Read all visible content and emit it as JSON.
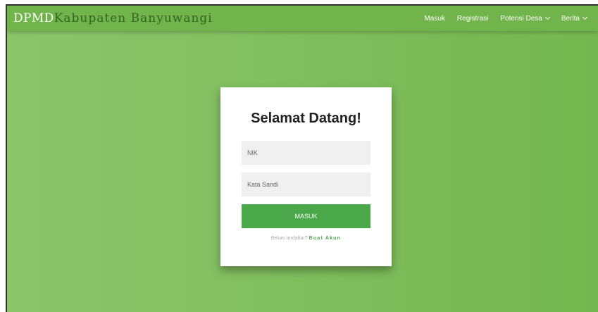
{
  "navbar": {
    "brand_strong": "DPMD",
    "brand_light": "Kabupaten Banyuwangi",
    "links": [
      {
        "label": "Masuk"
      },
      {
        "label": "Registrasi"
      },
      {
        "label": "Potensi Desa"
      },
      {
        "label": "Berita"
      }
    ]
  },
  "login": {
    "title": "Selamat Datang!",
    "nik_placeholder": "NIK",
    "password_placeholder": "Kata Sandi",
    "submit_label": "MASUK",
    "signup_prompt": "Belum terdaftar?",
    "signup_link": "Buat Akun"
  },
  "colors": {
    "primary_green": "#4aa84a",
    "navbar_green": "#71b44b",
    "background_green": "#82bf5f"
  },
  "icons": {
    "dropdown": "chevron-down-icon"
  }
}
